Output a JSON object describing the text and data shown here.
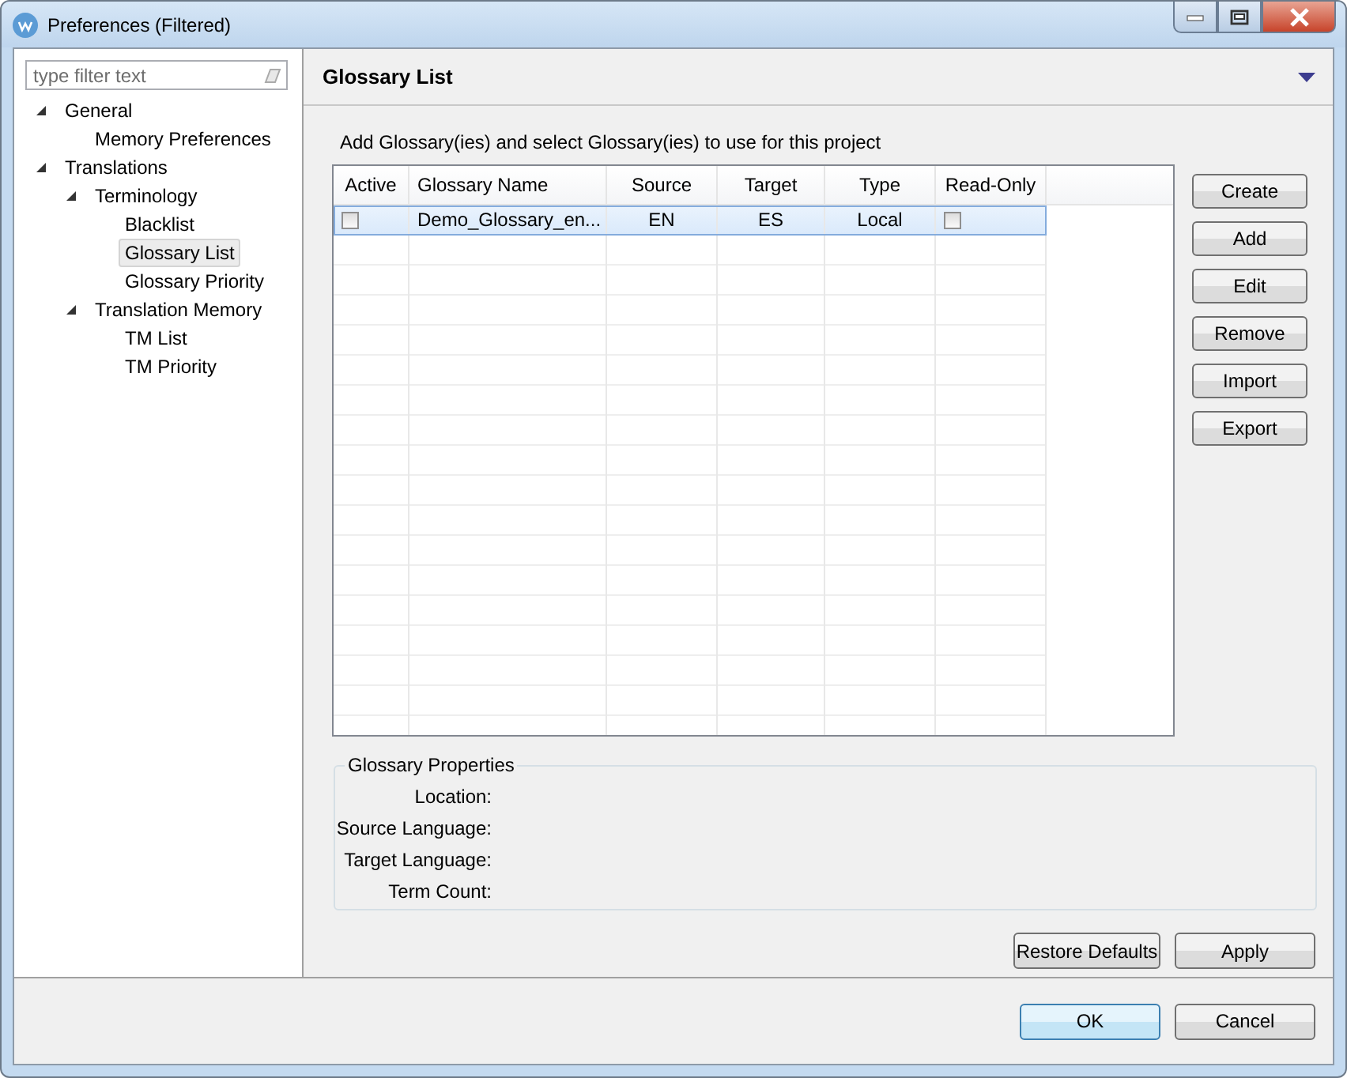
{
  "window": {
    "title": "Preferences (Filtered)"
  },
  "filter": {
    "placeholder": "type filter text"
  },
  "tree": [
    {
      "label": "General",
      "expanded": true,
      "selected": false,
      "children": [
        {
          "label": "Memory Preferences",
          "selected": false
        }
      ]
    },
    {
      "label": "Translations",
      "expanded": true,
      "selected": false,
      "children": [
        {
          "label": "Terminology",
          "expanded": true,
          "selected": false,
          "children": [
            {
              "label": "Blacklist",
              "selected": false
            },
            {
              "label": "Glossary List",
              "selected": true
            },
            {
              "label": "Glossary Priority",
              "selected": false
            }
          ]
        },
        {
          "label": "Translation Memory",
          "expanded": true,
          "selected": false,
          "children": [
            {
              "label": "TM List",
              "selected": false
            },
            {
              "label": "TM Priority",
              "selected": false
            }
          ]
        }
      ]
    }
  ],
  "page": {
    "title": "Glossary List",
    "description": "Add Glossary(ies) and select Glossary(ies) to use for this project"
  },
  "table": {
    "columns": [
      "Active",
      "Glossary Name",
      "Source",
      "Target",
      "Type",
      "Read-Only"
    ],
    "rows": [
      {
        "selected": true,
        "active": false,
        "name": "Demo_Glossary_en...",
        "source": "EN",
        "target": "ES",
        "type": "Local",
        "read_only": false
      }
    ]
  },
  "side_buttons": [
    "Create",
    "Add",
    "Edit",
    "Remove",
    "Import",
    "Export"
  ],
  "properties": {
    "title": "Glossary Properties",
    "labels": [
      "Location:",
      "Source Language:",
      "Target Language:",
      "Term Count:"
    ]
  },
  "page_buttons": [
    "Restore Defaults",
    "Apply"
  ],
  "dialog_buttons": [
    {
      "label": "OK",
      "default": true
    },
    {
      "label": "Cancel",
      "default": false
    }
  ]
}
